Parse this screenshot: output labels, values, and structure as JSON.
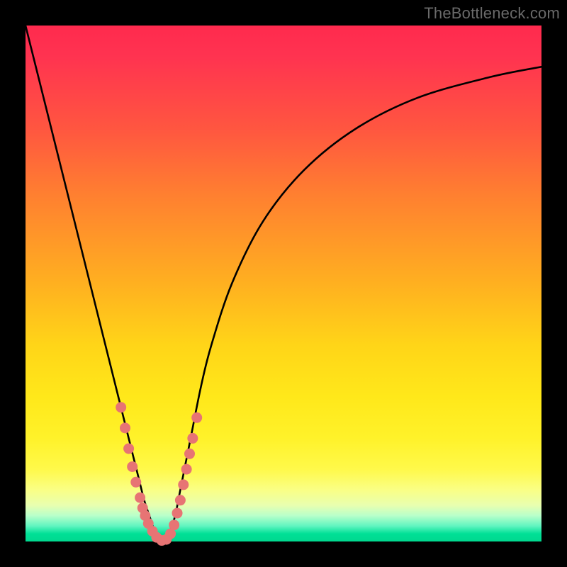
{
  "watermark": {
    "text": "TheBottleneck.com"
  },
  "colors": {
    "curve": "#000000",
    "marker_fill": "#e77474",
    "marker_stroke": "#e77474",
    "frame": "#000000"
  },
  "chart_data": {
    "type": "line",
    "title": "",
    "xlabel": "",
    "ylabel": "",
    "xlim": [
      0,
      100
    ],
    "ylim": [
      0,
      100
    ],
    "grid": false,
    "legend": false,
    "series": [
      {
        "name": "bottleneck-curve",
        "x": [
          0,
          2,
          4,
          6,
          8,
          10,
          12,
          14,
          16,
          18,
          20,
          21,
          22,
          23,
          24,
          25,
          26,
          27,
          28,
          29,
          30,
          31,
          32,
          34,
          36,
          40,
          46,
          54,
          64,
          76,
          90,
          100
        ],
        "y": [
          100,
          92,
          84,
          76,
          68,
          60,
          52,
          44,
          36,
          28,
          20,
          16,
          12,
          8,
          5,
          2,
          0,
          0,
          2,
          5,
          10,
          15,
          20,
          30,
          38,
          50,
          62,
          72,
          80,
          86,
          90,
          92
        ]
      }
    ],
    "markers": [
      {
        "x": 18.5,
        "y": 26
      },
      {
        "x": 19.3,
        "y": 22
      },
      {
        "x": 20.0,
        "y": 18
      },
      {
        "x": 20.7,
        "y": 14.5
      },
      {
        "x": 21.4,
        "y": 11.5
      },
      {
        "x": 22.2,
        "y": 8.5
      },
      {
        "x": 22.7,
        "y": 6.5
      },
      {
        "x": 23.2,
        "y": 5.0
      },
      {
        "x": 23.8,
        "y": 3.5
      },
      {
        "x": 24.6,
        "y": 2.0
      },
      {
        "x": 25.4,
        "y": 0.8
      },
      {
        "x": 26.4,
        "y": 0.2
      },
      {
        "x": 27.3,
        "y": 0.4
      },
      {
        "x": 28.1,
        "y": 1.5
      },
      {
        "x": 28.8,
        "y": 3.2
      },
      {
        "x": 29.4,
        "y": 5.5
      },
      {
        "x": 30.0,
        "y": 8.0
      },
      {
        "x": 30.6,
        "y": 11.0
      },
      {
        "x": 31.2,
        "y": 14.0
      },
      {
        "x": 31.8,
        "y": 17.0
      },
      {
        "x": 32.4,
        "y": 20.0
      },
      {
        "x": 33.2,
        "y": 24.0
      }
    ]
  }
}
